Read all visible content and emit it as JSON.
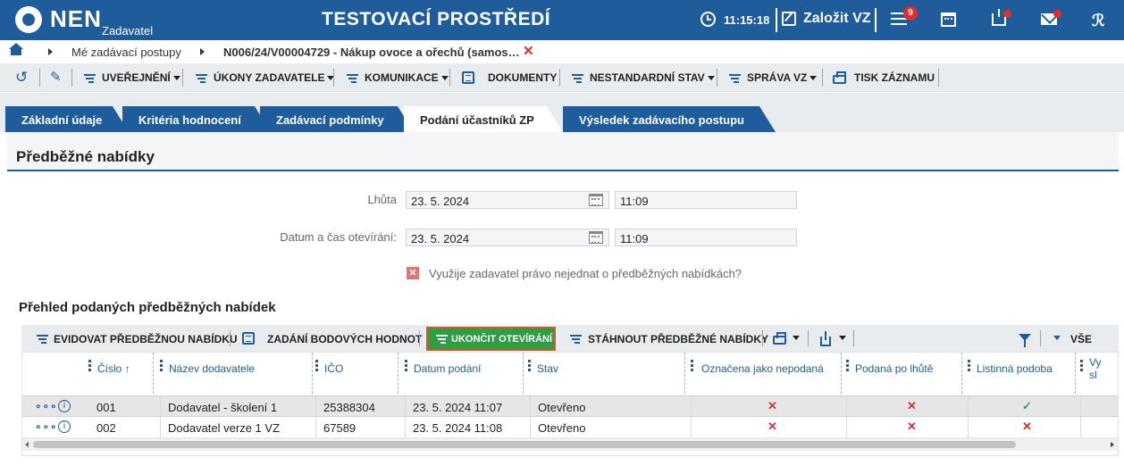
{
  "header": {
    "logo": "NEN",
    "logo_sub": "Zadavatel",
    "env_title": "TESTOVACÍ PROSTŘEDÍ",
    "clock": "11:15:18",
    "new_label": "Založit VZ",
    "badge_count": "9",
    "user_icon": "user-icon"
  },
  "breadcrumb": {
    "item1": "Mé zadávací postupy",
    "item2": "N006/24/V00004729 - Nákup ovoce a ořechů (samos…",
    "close": "✕"
  },
  "toolbar": {
    "publish": "UVEŘEJNĚNÍ",
    "actions": "ÚKONY ZADAVATELE",
    "communication": "KOMUNIKACE",
    "documents": "DOKUMENTY",
    "nonstandard": "NESTANDARDNÍ STAV",
    "manage": "SPRÁVA VZ",
    "print": "TISK ZÁZNAMU"
  },
  "tabs": [
    {
      "label": "Základní údaje",
      "active": false
    },
    {
      "label": "Kritéria hodnocení",
      "active": false
    },
    {
      "label": "Zadávací podmínky",
      "active": false
    },
    {
      "label": "Podání účastníků ZP",
      "active": true
    },
    {
      "label": "Výsledek zadávacího postupu",
      "active": false
    }
  ],
  "section": {
    "title": "Předběžné nabídky",
    "deadline_label": "Lhůta",
    "deadline_date": "23. 5. 2024",
    "deadline_time": "11:09",
    "opening_label": "Datum a čas otevírání:",
    "opening_date": "23. 5. 2024",
    "opening_time": "11:09",
    "checkbox_label": "Využije zadavatel právo nejednat o předběžných nabídkách?",
    "checkbox_state": "✕"
  },
  "grid": {
    "title": "Přehled podaných předběžných nabídek",
    "toolbar": {
      "register": "EVIDOVAT PŘEDBĚŽNOU NABÍDKU",
      "score": "ZADÁNÍ BODOVÝCH HODNOT",
      "finish": "UKONČIT OTEVÍRÁNÍ",
      "download": "STÁHNOUT PŘEDBĚŽNÉ NABÍDKY",
      "all": "VŠE"
    },
    "columns": [
      "Číslo",
      "Název dodavatele",
      "IČO",
      "Datum podání",
      "Stav",
      "Označena jako nepodaná",
      "Podaná po lhůtě",
      "Listinná podoba",
      "Vy sl"
    ],
    "sort_indicator": "↑",
    "rows": [
      {
        "number": "001",
        "supplier": "Dodavatel - školení 1",
        "ico": "25388304",
        "date": "23. 5. 2024 11:07",
        "status": "Otevřeno",
        "not_submitted": "✕",
        "late": "✕",
        "paper": "✓"
      },
      {
        "number": "002",
        "supplier": "Dodavatel verze 1 VZ",
        "ico": "67589",
        "date": "23. 5. 2024 11:08",
        "status": "Otevřeno",
        "not_submitted": "✕",
        "late": "✕",
        "paper": "✕"
      }
    ]
  },
  "colors": {
    "brand": "#1e5c9b",
    "green": "#2e9e43",
    "red": "#e52b2b"
  }
}
